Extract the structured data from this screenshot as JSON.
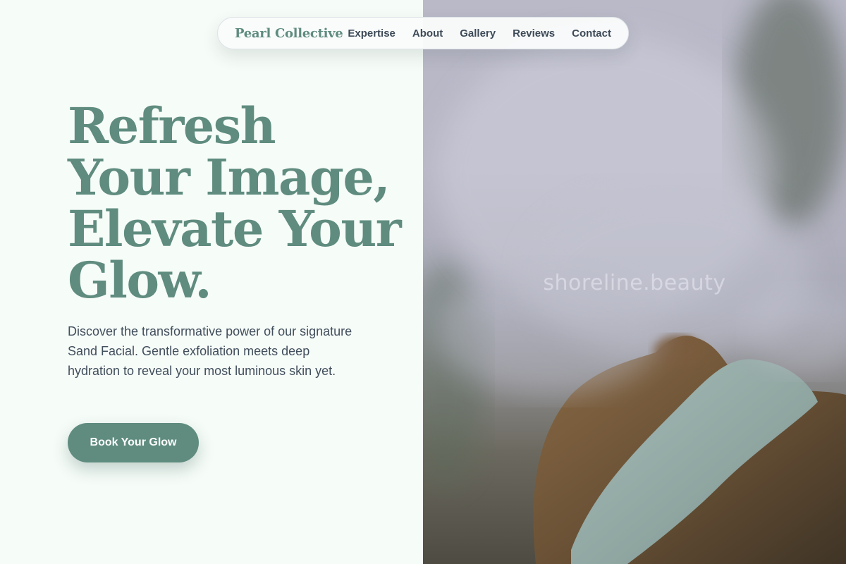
{
  "nav": {
    "brand": "Pearl Collective",
    "links": [
      "Expertise",
      "About",
      "Gallery",
      "Reviews",
      "Contact"
    ]
  },
  "hero": {
    "headline_lines": [
      "Refresh",
      "Your Image,",
      "Elevate Your",
      "Glow."
    ],
    "subtext": "Discover the transformative power of our signature Sand Facial. Gentle exfoliation meets deep hydration to reveal your most luminous skin yet.",
    "cta_label": "Book Your Glow"
  },
  "image": {
    "watermark": "shoreline.beauty",
    "description_icon": "spa-steam-facial-photo"
  },
  "colors": {
    "brand": "#5f8c7f",
    "background": "#f6fcf8",
    "body_text": "#414e5c",
    "nav_text": "#3d4a57"
  }
}
